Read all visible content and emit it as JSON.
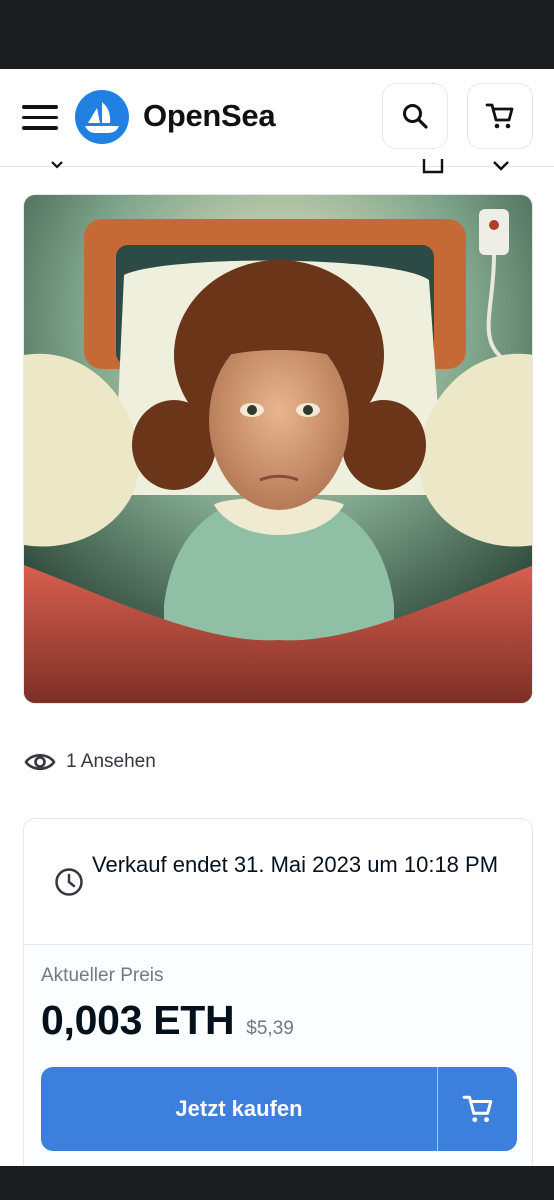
{
  "header": {
    "brand": "OpenSea",
    "menu_icon": "hamburger-menu-icon",
    "search_icon": "search-icon",
    "cart_icon": "cart-icon"
  },
  "nft": {
    "image_description_icon": "nft-artwork"
  },
  "views": {
    "icon": "eye-icon",
    "text": "1 Ansehen"
  },
  "sale": {
    "icon": "clock-icon",
    "text": "Verkauf endet 31. Mai 2023 um 10:18 PM"
  },
  "price": {
    "label": "Aktueller Preis",
    "eth": "0,003 ETH",
    "usd": "$5,39"
  },
  "actions": {
    "buy_label": "Jetzt kaufen",
    "add_to_cart_icon": "cart-icon"
  },
  "colors": {
    "accent": "#2081e2",
    "button": "#3d7fdc",
    "status_bar": "#1b1c1e"
  }
}
